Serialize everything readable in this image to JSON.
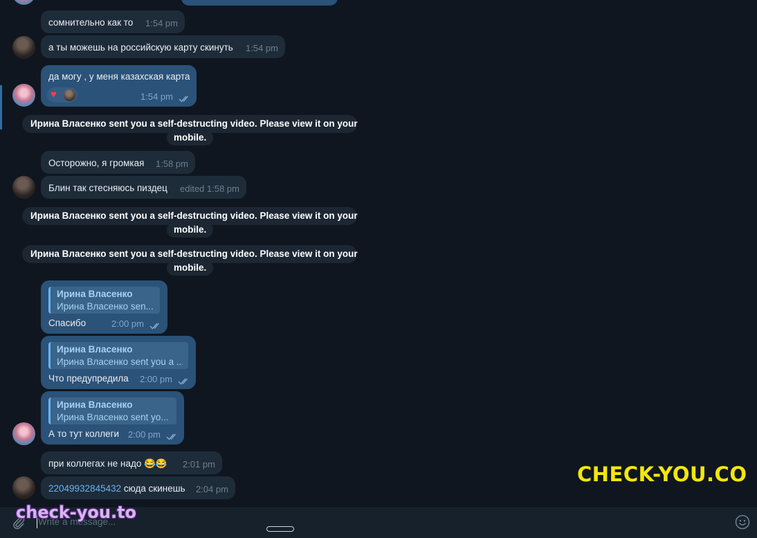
{
  "messages": [
    {
      "text": "сомнительно как то",
      "time": "1:54 pm"
    },
    {
      "text": "а ты можешь на российскую карту скинуть",
      "time": "1:54 pm"
    },
    {
      "text": "да могу , у меня казахская карта",
      "time": "1:54 pm",
      "reaction": "heart"
    },
    {
      "text": "Осторожно, я громкая",
      "time": "1:58 pm"
    },
    {
      "text": "Блин так стесняюсь пиздец",
      "time": "edited 1:58 pm"
    },
    {
      "reply_name": "Ирина Власенко",
      "reply_text": "Ирина Власенко sen...",
      "text": "Спасибо",
      "time": "2:00 pm"
    },
    {
      "reply_name": "Ирина Власенко",
      "reply_text": "Ирина Власенко sent you a ...",
      "text": "Что предупредила",
      "time": "2:00 pm"
    },
    {
      "reply_name": "Ирина Власенко",
      "reply_text": "Ирина Власенко sent yo...",
      "text": "А то тут коллеги",
      "time": "2:00 pm"
    },
    {
      "text": "при коллегах не надо 😂😂",
      "time": "2:01 pm"
    },
    {
      "link": "22049932845432",
      "text": " сюда скинешь",
      "time": "2:04 pm"
    }
  ],
  "service": [
    {
      "line1": "Ирина Власенко sent you a self-destructing video. Please view it on your",
      "line2": "mobile."
    },
    {
      "line1": "Ирина Власенко sent you a self-destructing video. Please view it on your",
      "line2": "mobile."
    },
    {
      "line1": "Ирина Власенко sent you a self-destructing video. Please view it on your",
      "line2": "mobile."
    }
  ],
  "composer": {
    "placeholder": "Write a message..."
  },
  "watermarks": {
    "big": "CHECK-YOU.CO",
    "small": "check-you.to"
  },
  "colors": {
    "background": "#0f1620",
    "incoming": "#1e2c3a",
    "outgoing": "#2b5278",
    "accent": "#6ab2f2",
    "watermark": "#f4e60b"
  }
}
